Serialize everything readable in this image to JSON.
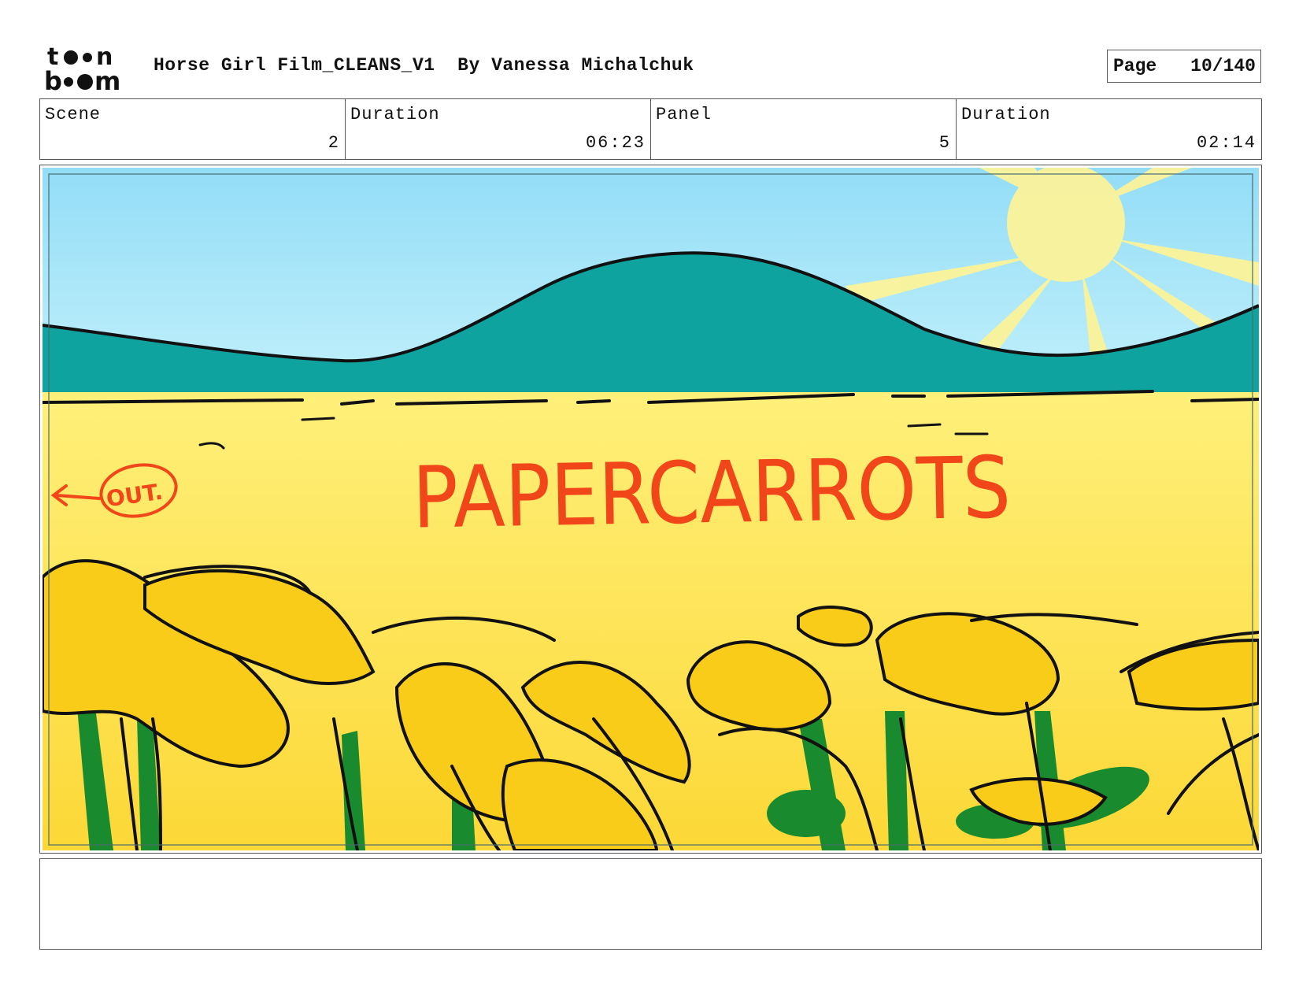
{
  "header": {
    "logo_top": "to•n",
    "logo_bottom": "b••m",
    "title": "Horse Girl Film_CLEANS_V1  By Vanessa Michalchuk",
    "page_label": "Page",
    "page_value": "10/140"
  },
  "info": [
    {
      "label": "Scene",
      "value": "2"
    },
    {
      "label": "Duration",
      "value": "06:23"
    },
    {
      "label": "Panel",
      "value": "5"
    },
    {
      "label": "Duration",
      "value": "02:14"
    }
  ],
  "panel": {
    "headline": "PAPERCARROTS",
    "out_label": "OUT.",
    "colors": {
      "sky": "#a8e6f8",
      "hill": "#0fa3a0",
      "field": "#fde25a",
      "flower": "#f8cc18",
      "stem": "#1a8a2e",
      "text": "#f0461a",
      "ink": "#111111"
    }
  },
  "notes": {
    "text": ""
  }
}
